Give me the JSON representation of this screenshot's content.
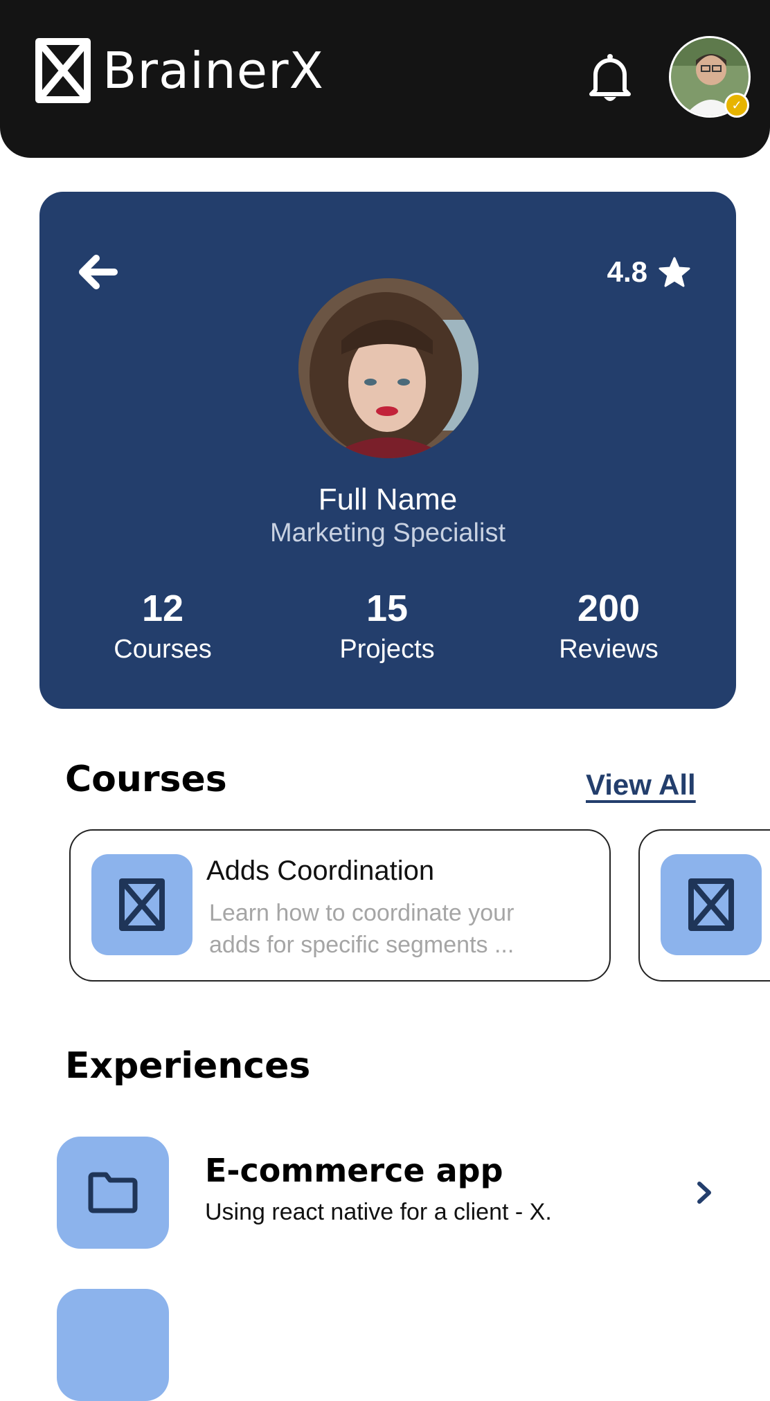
{
  "app": {
    "name": "BrainerX"
  },
  "header": {
    "notifications_icon": "bell-icon",
    "avatar_badge_icon": "verified-check-icon"
  },
  "profile": {
    "rating": "4.8",
    "rating_icon": "star-icon",
    "full_name": "Full Name",
    "role": "Marketing Specialist",
    "stats": [
      {
        "value": "12",
        "label": "Courses"
      },
      {
        "value": "15",
        "label": "Projects"
      },
      {
        "value": "200",
        "label": "Reviews"
      }
    ]
  },
  "courses": {
    "title": "Courses",
    "view_all": "View All",
    "items": [
      {
        "title": "Adds Coordination",
        "description": "Learn how to coordinate your adds for specific segments ..."
      }
    ]
  },
  "experiences": {
    "title": "Experiences",
    "items": [
      {
        "title": "E-commerce app",
        "description": "Using react native for a client - X.",
        "icon": "folder-icon"
      }
    ]
  },
  "colors": {
    "header_bg": "#141414",
    "card_bg": "#233e6c",
    "accent_light": "#8cb3ec",
    "link": "#233e6c"
  }
}
